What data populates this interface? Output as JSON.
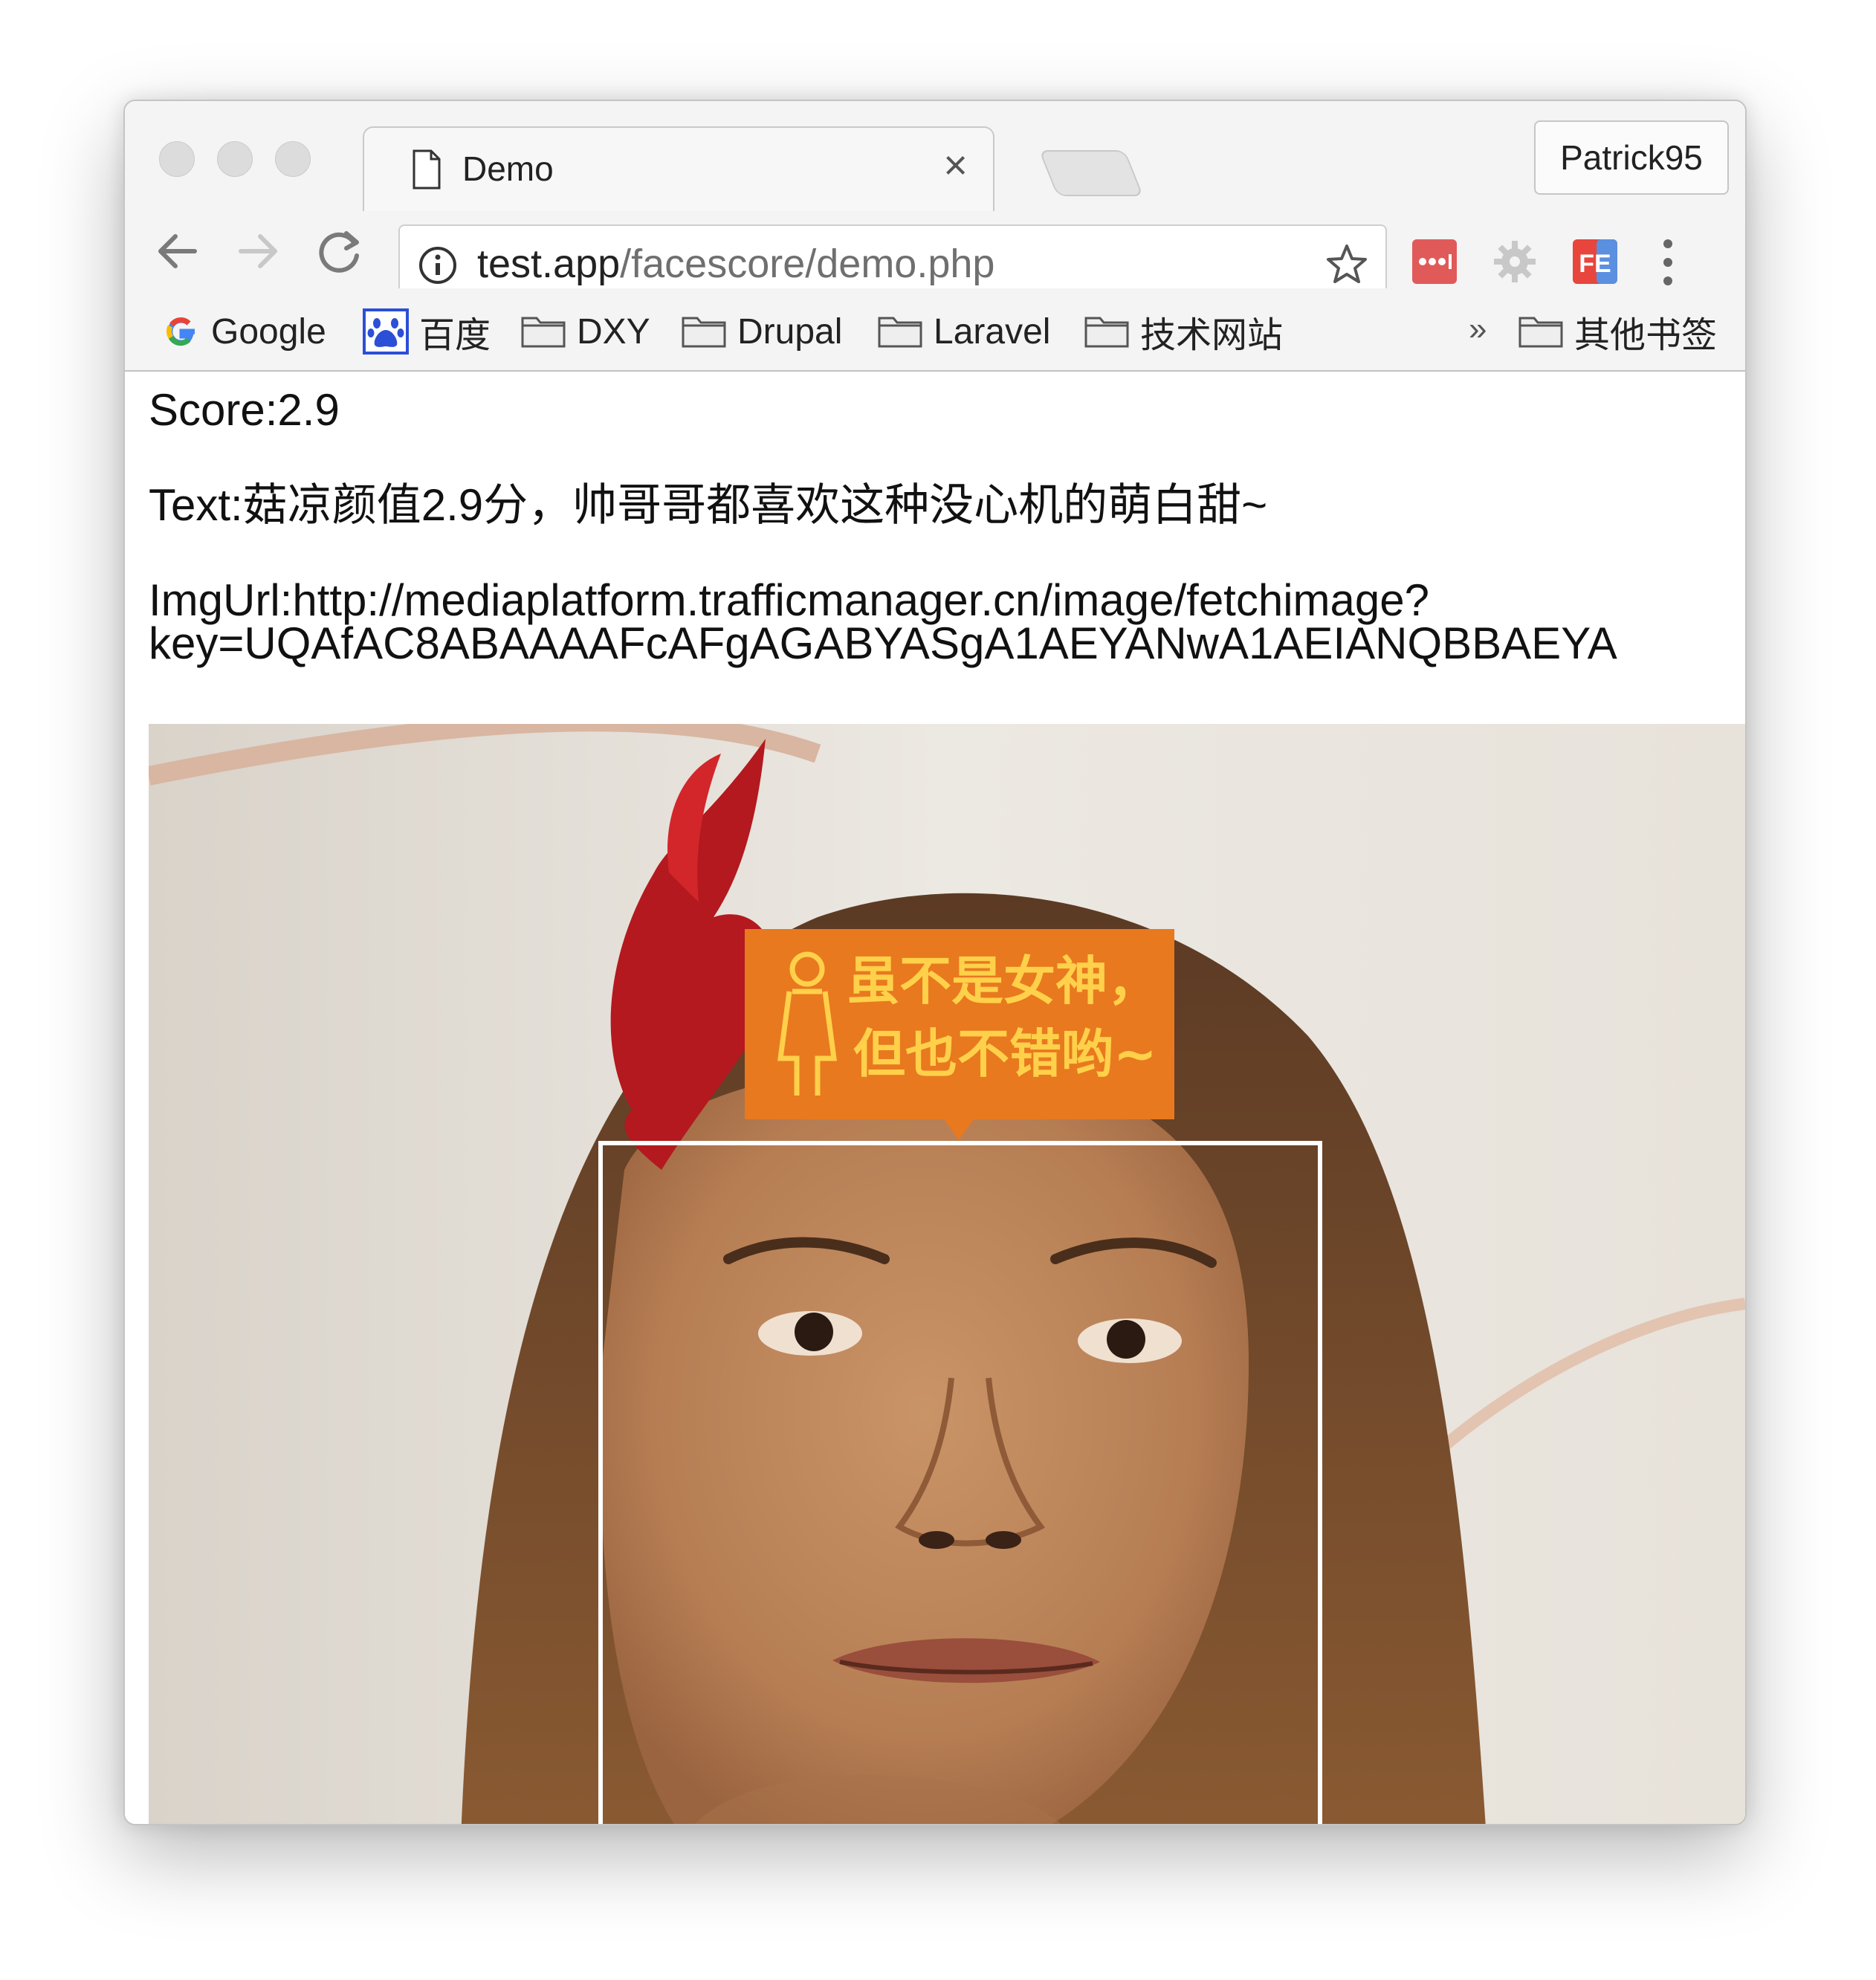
{
  "tab": {
    "title": "Demo",
    "close_symbol": "×"
  },
  "profile": {
    "name": "Patrick95"
  },
  "address_bar": {
    "host": "test.app",
    "path": "/facescore/demo.php"
  },
  "bookmarks": [
    {
      "label": "Google",
      "icon": "google-icon"
    },
    {
      "label": "百度",
      "icon": "baidu-icon"
    },
    {
      "label": "DXY",
      "icon": "folder-icon"
    },
    {
      "label": "Drupal",
      "icon": "folder-icon"
    },
    {
      "label": "Laravel",
      "icon": "folder-icon"
    },
    {
      "label": "技术网站",
      "icon": "folder-icon"
    }
  ],
  "bookmarks_overflow": "»",
  "other_bookmarks": {
    "label": "其他书签",
    "icon": "folder-icon"
  },
  "extensions": [
    {
      "name": "lastpass-icon"
    },
    {
      "name": "gear-extension-icon"
    },
    {
      "name": "fe-helper-icon",
      "text": "FE"
    }
  ],
  "page": {
    "score": "Score:2.9",
    "text": "Text:菇凉颜值2.9分，帅哥哥都喜欢这种没心机的萌白甜~",
    "img_url_line1": "ImgUrl:http://mediaplatform.trafficmanager.cn/image/fetchimage?",
    "img_url_line2": "key=UQAfAC8ABAAAAFcAFgAGABYASgA1AEYANwA1AEIANQBBAEYA"
  },
  "face_badge": {
    "line1": "虽不是女神，",
    "line2": "但也不错哟~",
    "color": "#e8791f",
    "text_color": "#ffd04a"
  },
  "colors": {
    "chrome_bg": "#f4f4f4",
    "ext_red": "#e05a5a",
    "fe_red": "#e8453c"
  }
}
